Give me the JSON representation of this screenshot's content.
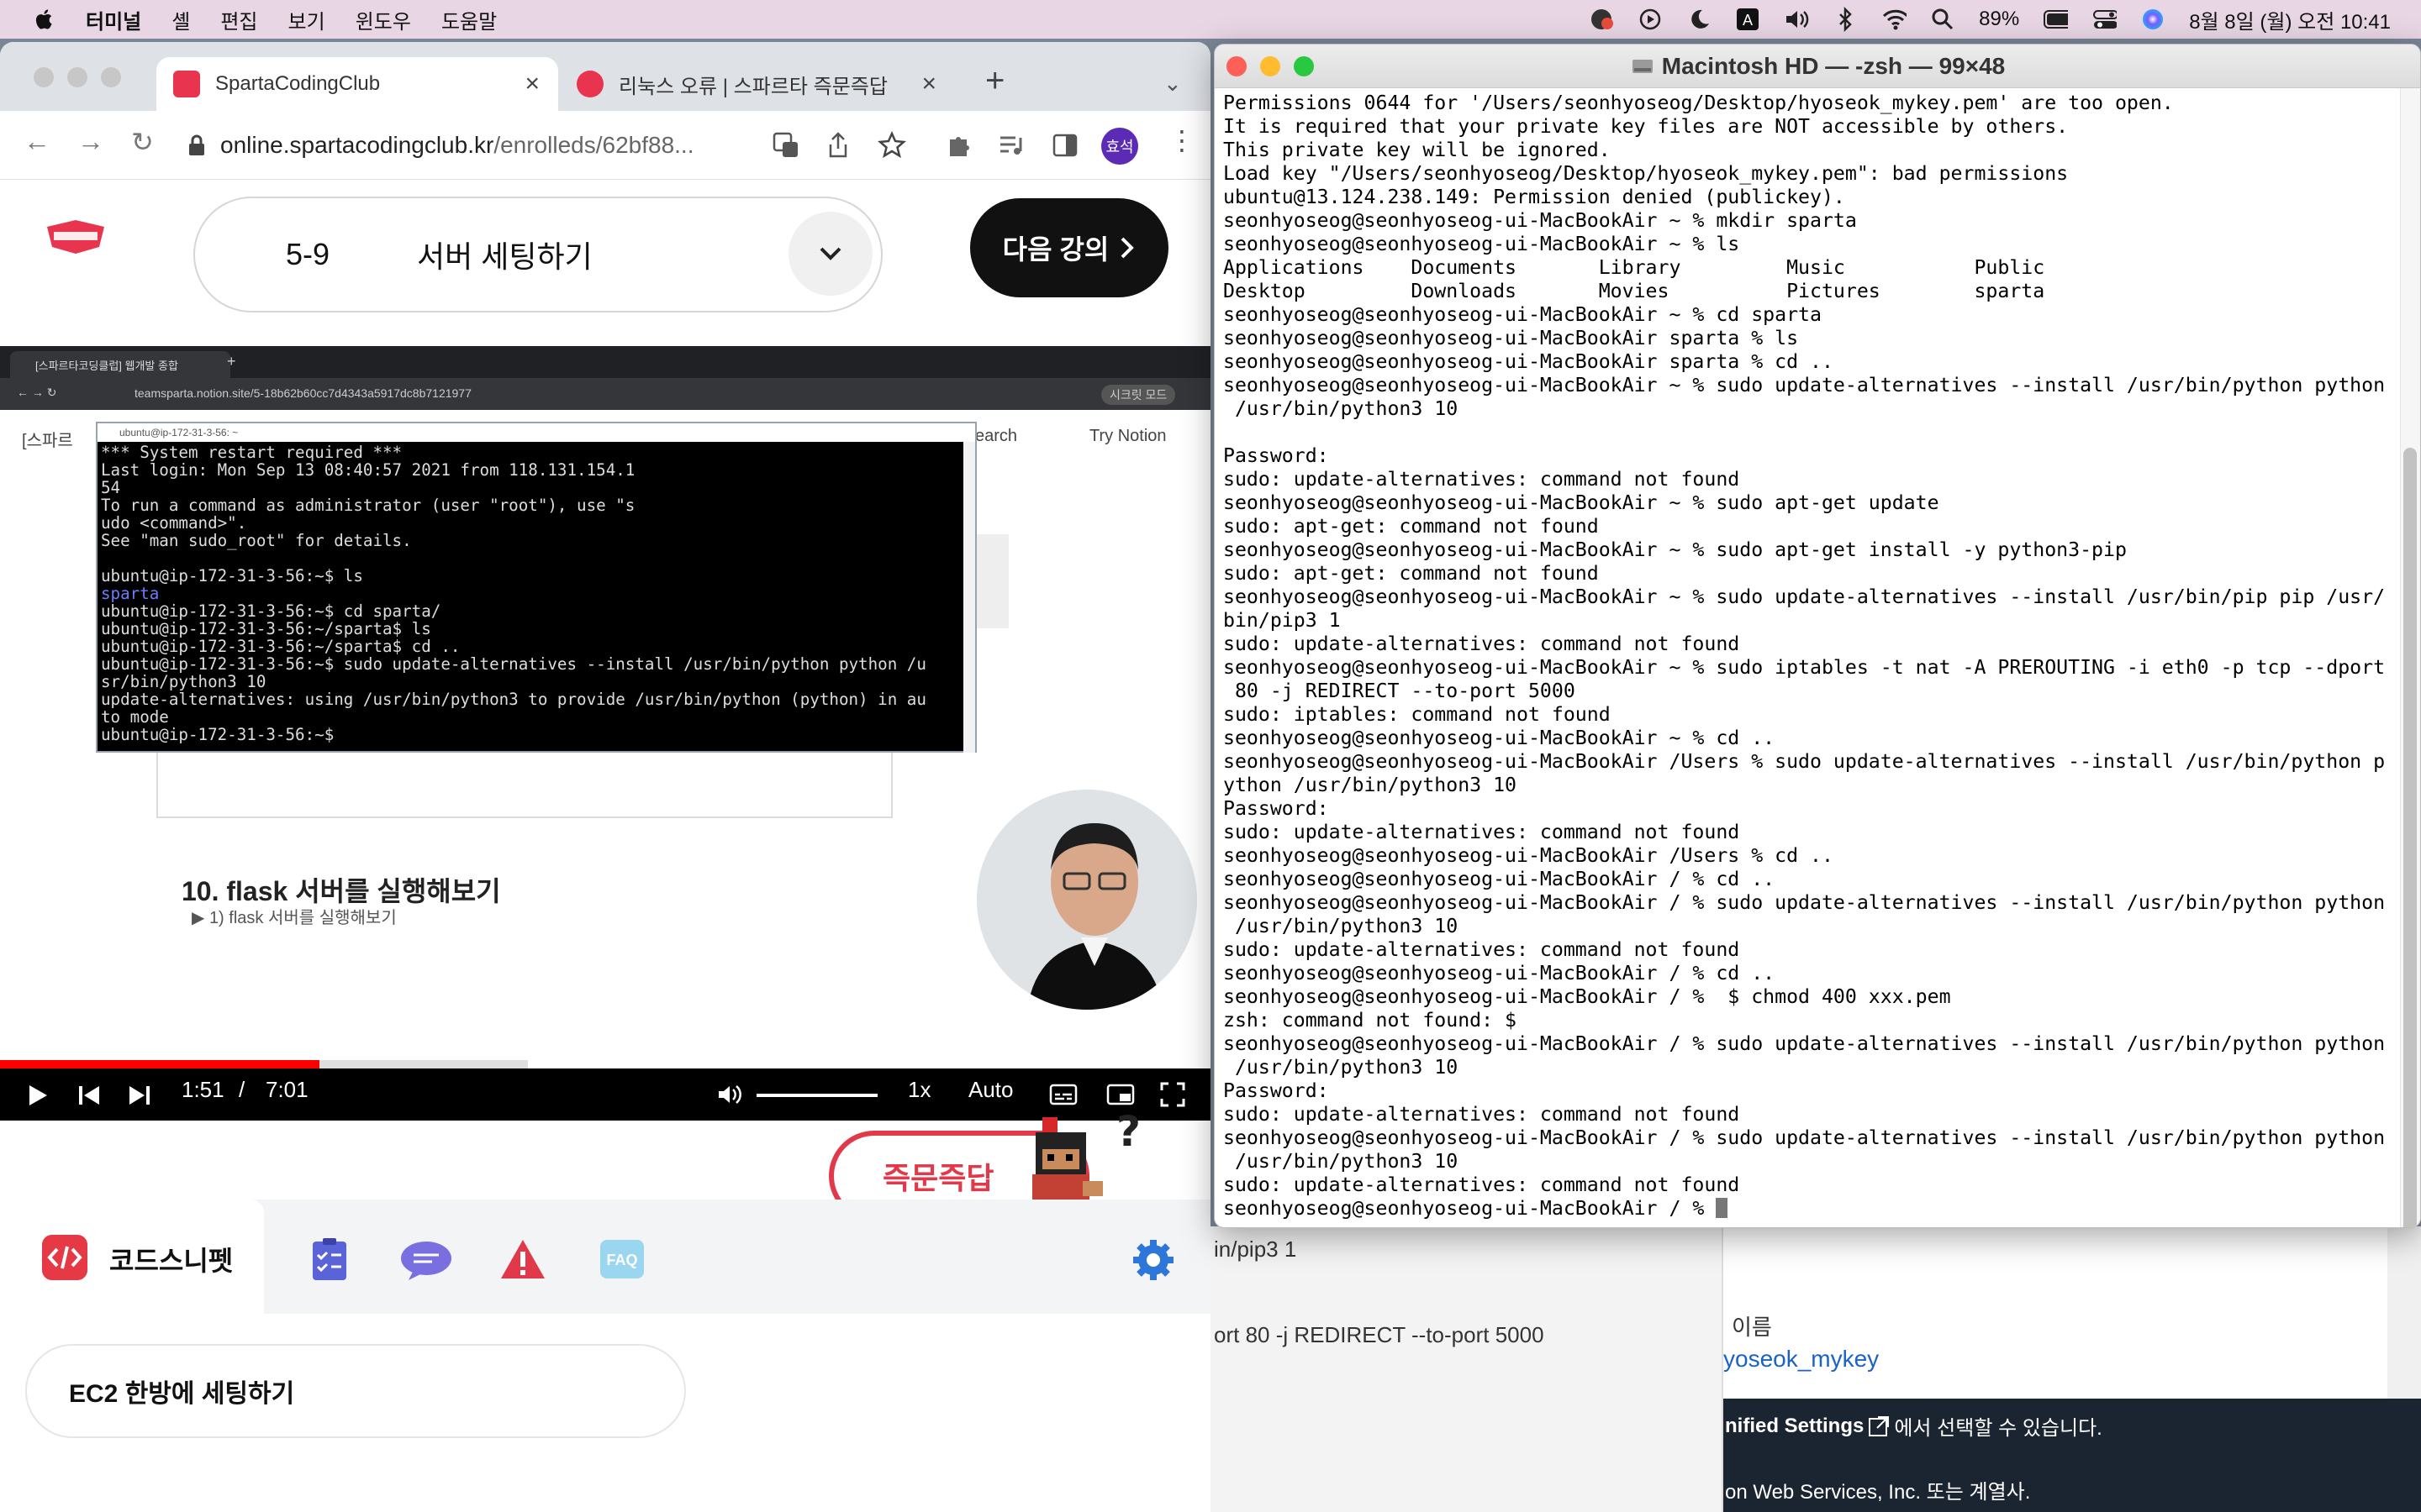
{
  "menubar": {
    "app": "터미널",
    "items": [
      "셸",
      "편집",
      "보기",
      "윈도우",
      "도움말"
    ],
    "battery": "89%",
    "datetime": "8월 8일 (월) 오전  10:41"
  },
  "browser": {
    "tabs": [
      {
        "title": "SpartaCodingClub"
      },
      {
        "title": "리눅스 오류 | 스파르타 즉문즉답"
      }
    ],
    "url_domain": "online.spartacodingclub.kr",
    "url_path": "/enrolleds/62bf88...",
    "profile": "효석"
  },
  "lesson": {
    "number": "5-9",
    "title": "서버 세팅하기",
    "next_label": "다음 강의"
  },
  "video": {
    "inner_tab": "[스파르타코딩클럽] 웹개발 종합",
    "inner_url": "teamsparta.notion.site/5-18b62b60cc7d4343a5917dc8b7121977",
    "inner_mode": "시크릿 모드",
    "notion_search": "earch",
    "notion_try": "Try Notion",
    "notion_left": "[스파르",
    "section_title": "10. flask 서버를 실행해보기",
    "section_sub": "▶ 1) flask 서버를 실행해보기",
    "putty_title": "ubuntu@ip-172-31-3-56: ~",
    "putty_lines": [
      "*** System restart required ***",
      "Last login: Mon Sep 13 08:40:57 2021 from 118.131.154.1",
      "54",
      "To run a command as administrator (user \"root\"), use \"s",
      "udo <command>\".",
      "See \"man sudo_root\" for details.",
      "",
      "ubuntu@ip-172-31-3-56:~$ ls",
      "sparta",
      "ubuntu@ip-172-31-3-56:~$ cd sparta/",
      "ubuntu@ip-172-31-3-56:~/sparta$ ls",
      "ubuntu@ip-172-31-3-56:~/sparta$ cd ..",
      "ubuntu@ip-172-31-3-56:~$ sudo update-alternatives --install /usr/bin/python python /u",
      "sr/bin/python3 10",
      "update-alternatives: using /usr/bin/python3 to provide /usr/bin/python (python) in au",
      "to mode",
      "ubuntu@ip-172-31-3-56:~$"
    ],
    "current_time": "1:51",
    "separator": "/",
    "duration": "7:01",
    "speed": "1x",
    "quality": "Auto",
    "played_fraction": 0.264,
    "buffered_fraction": 0.436
  },
  "quick_answer": "즉문즉답",
  "snippet": {
    "label": "코드스니펫",
    "faq": "FAQ",
    "item": "EC2 한방에 세팅하기"
  },
  "terminal": {
    "title": "Macintosh HD — -zsh — 99×48",
    "lines": [
      "Permissions 0644 for '/Users/seonhyoseog/Desktop/hyoseok_mykey.pem' are too open.",
      "It is required that your private key files are NOT accessible by others.",
      "This private key will be ignored.",
      "Load key \"/Users/seonhyoseog/Desktop/hyoseok_mykey.pem\": bad permissions",
      "ubuntu@13.124.238.149: Permission denied (publickey).",
      "seonhyoseog@seonhyoseog-ui-MacBookAir ~ % mkdir sparta",
      "seonhyoseog@seonhyoseog-ui-MacBookAir ~ % ls",
      "Applications    Documents       Library         Music           Public",
      "Desktop         Downloads       Movies          Pictures        sparta",
      "seonhyoseog@seonhyoseog-ui-MacBookAir ~ % cd sparta",
      "seonhyoseog@seonhyoseog-ui-MacBookAir sparta % ls",
      "seonhyoseog@seonhyoseog-ui-MacBookAir sparta % cd ..",
      "seonhyoseog@seonhyoseog-ui-MacBookAir ~ % sudo update-alternatives --install /usr/bin/python python",
      " /usr/bin/python3 10",
      "",
      "Password:",
      "sudo: update-alternatives: command not found",
      "seonhyoseog@seonhyoseog-ui-MacBookAir ~ % sudo apt-get update",
      "sudo: apt-get: command not found",
      "seonhyoseog@seonhyoseog-ui-MacBookAir ~ % sudo apt-get install -y python3-pip",
      "sudo: apt-get: command not found",
      "seonhyoseog@seonhyoseog-ui-MacBookAir ~ % sudo update-alternatives --install /usr/bin/pip pip /usr/",
      "bin/pip3 1",
      "sudo: update-alternatives: command not found",
      "seonhyoseog@seonhyoseog-ui-MacBookAir ~ % sudo iptables -t nat -A PREROUTING -i eth0 -p tcp --dport",
      " 80 -j REDIRECT --to-port 5000",
      "sudo: iptables: command not found",
      "seonhyoseog@seonhyoseog-ui-MacBookAir ~ % cd ..",
      "seonhyoseog@seonhyoseog-ui-MacBookAir /Users % sudo update-alternatives --install /usr/bin/python p",
      "ython /usr/bin/python3 10",
      "Password:",
      "sudo: update-alternatives: command not found",
      "seonhyoseog@seonhyoseog-ui-MacBookAir /Users % cd ..",
      "seonhyoseog@seonhyoseog-ui-MacBookAir / % cd ..",
      "seonhyoseog@seonhyoseog-ui-MacBookAir / % sudo update-alternatives --install /usr/bin/python python",
      " /usr/bin/python3 10",
      "sudo: update-alternatives: command not found",
      "seonhyoseog@seonhyoseog-ui-MacBookAir / % cd ..",
      "seonhyoseog@seonhyoseog-ui-MacBookAir / %  $ chmod 400 xxx.pem",
      "zsh: command not found: $",
      "seonhyoseog@seonhyoseog-ui-MacBookAir / % sudo update-alternatives --install /usr/bin/python python",
      " /usr/bin/python3 10",
      "Password:",
      "sudo: update-alternatives: command not found",
      "seonhyoseog@seonhyoseog-ui-MacBookAir / % sudo update-alternatives --install /usr/bin/python python",
      " /usr/bin/python3 10",
      "sudo: update-alternatives: command not found"
    ],
    "prompt": "seonhyoseog@seonhyoseog-ui-MacBookAir / % "
  },
  "background": {
    "line1": "in/pip3 1",
    "line2": "ort 80 -j REDIRECT --to-port 5000",
    "name_label": "이름",
    "key_name": "yoseok_mykey",
    "unified_bold": "nified Settings",
    "unified_rest": "에서 선택할 수 있습니다.",
    "aws": "on Web Services, Inc. 또는 계열사."
  },
  "colors": {
    "accent_red": "#e1384a",
    "progress_red": "#ff0000",
    "profile_purple": "#5b2bb5"
  }
}
